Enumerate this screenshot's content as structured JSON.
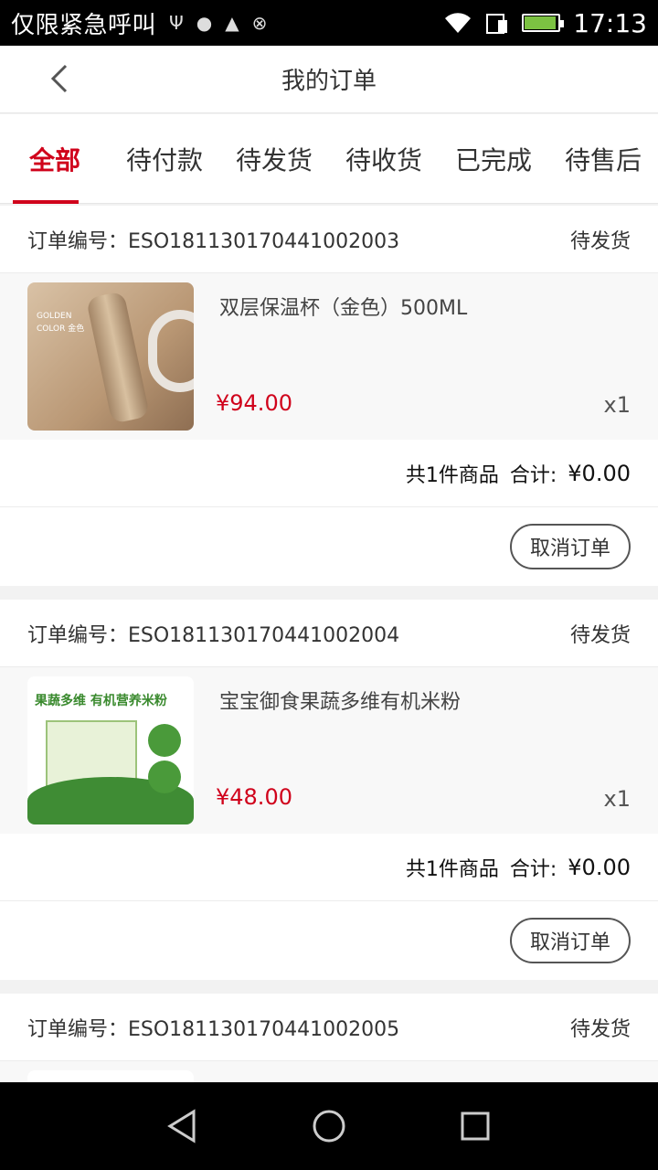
{
  "status_bar": {
    "carrier": "仅限紧急呼叫",
    "time": "17:13"
  },
  "header": {
    "title": "我的订单"
  },
  "tabs": [
    {
      "label": "全部",
      "active": true
    },
    {
      "label": "待付款",
      "active": false
    },
    {
      "label": "待发货",
      "active": false
    },
    {
      "label": "待收货",
      "active": false
    },
    {
      "label": "已完成",
      "active": false
    },
    {
      "label": "待售后",
      "active": false
    }
  ],
  "orders": [
    {
      "order_label": "订单编号：ESO181130170441002003",
      "status": "待发货",
      "item": {
        "name": "双层保温杯（金色）500ML",
        "price": "¥94.00",
        "qty": "x1",
        "image_text": "GOLDEN COLOR 金色"
      },
      "summary_count": "共1件商品",
      "summary_total_label": "合计:",
      "summary_total": "¥0.00",
      "action": "取消订单"
    },
    {
      "order_label": "订单编号：ESO181130170441002004",
      "status": "待发货",
      "item": {
        "name": "宝宝御食果蔬多维有机米粉",
        "price": "¥48.00",
        "qty": "x1",
        "image_text": "果蔬多维 有机营养米粉"
      },
      "summary_count": "共1件商品",
      "summary_total_label": "合计:",
      "summary_total": "¥0.00",
      "action": "取消订单"
    },
    {
      "order_label": "订单编号：ESO181130170441002005",
      "status": "待发货"
    }
  ],
  "colors": {
    "accent": "#d0021b"
  }
}
